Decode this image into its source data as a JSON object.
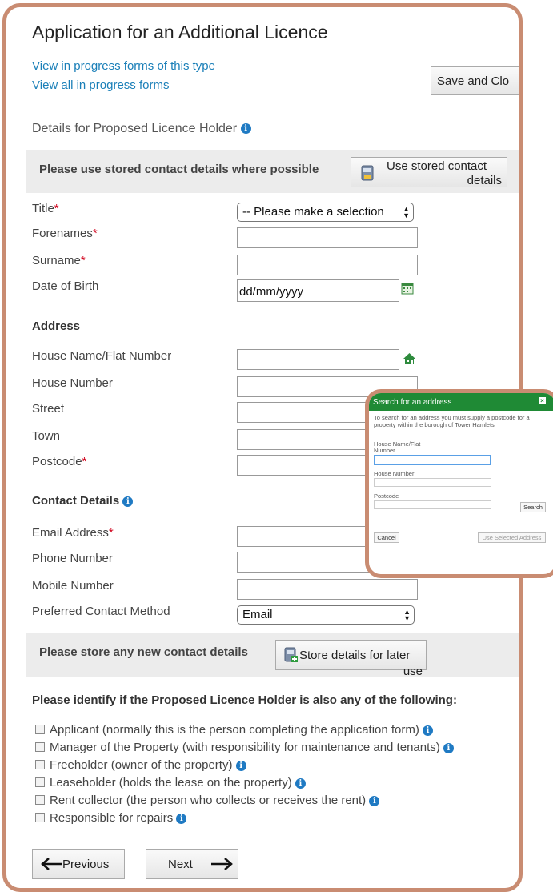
{
  "page": {
    "title": "Application for an Additional Licence",
    "links": [
      "View in progress forms of this type",
      "View all in progress forms"
    ],
    "save_close_label": "Save and Clo",
    "section_title": "Details for Proposed Licence Holder"
  },
  "stored_band": {
    "text": "Please use stored contact details where possible",
    "button_line1": "Use stored contact",
    "button_line2": "details"
  },
  "personal": {
    "title_label": "Title",
    "title_value": "-- Please make a selection",
    "forenames_label": "Forenames",
    "surname_label": "Surname",
    "dob_label": "Date of Birth",
    "dob_placeholder": "dd/mm/yyyy"
  },
  "address": {
    "heading": "Address",
    "house_name_label": "House Name/Flat Number",
    "house_number_label": "House Number",
    "street_label": "Street",
    "town_label": "Town",
    "postcode_label": "Postcode"
  },
  "contact": {
    "heading": "Contact Details",
    "email_label": "Email Address",
    "phone_label": "Phone Number",
    "mobile_label": "Mobile Number",
    "preferred_label": "Preferred Contact Method",
    "preferred_value": "Email"
  },
  "store_band": {
    "text": "Please store any new contact details",
    "button_line1": "Store details for later",
    "button_line2": "use"
  },
  "identify": {
    "heading": "Please identify if the Proposed Licence Holder is also any of the following:",
    "options": [
      "Applicant (normally this is the person completing the application form)",
      "Manager of the Property (with responsibility for maintenance and tenants)",
      "Freeholder (owner of the property)",
      "Leaseholder (holds the lease on the property)",
      "Rent collector (the person who collects or receives the rent)",
      "Responsible for repairs"
    ]
  },
  "nav": {
    "previous_label": "Previous",
    "next_label": "Next"
  },
  "popup": {
    "title": "Search for an address",
    "intro_line1": "To search for an address you must supply a postcode for a",
    "intro_line2": "property within the borough of Tower Hamlets",
    "house_name_line1": "House Name/Flat",
    "house_name_line2": "Number",
    "house_number_label": "House Number",
    "postcode_label": "Postcode",
    "search_label": "Search",
    "cancel_label": "Cancel",
    "use_selected_label": "Use Selected Address"
  },
  "colors": {
    "frame": "#c98c72",
    "link": "#1a7fb8",
    "required": "#d0021b",
    "popup_header": "#1f8a35",
    "info_icon": "#1f7ac3"
  },
  "icons": [
    "info-icon",
    "contact-card-icon",
    "calendar-icon",
    "house-search-icon",
    "store-details-icon",
    "arrow-left-icon",
    "arrow-right-icon",
    "close-icon"
  ]
}
